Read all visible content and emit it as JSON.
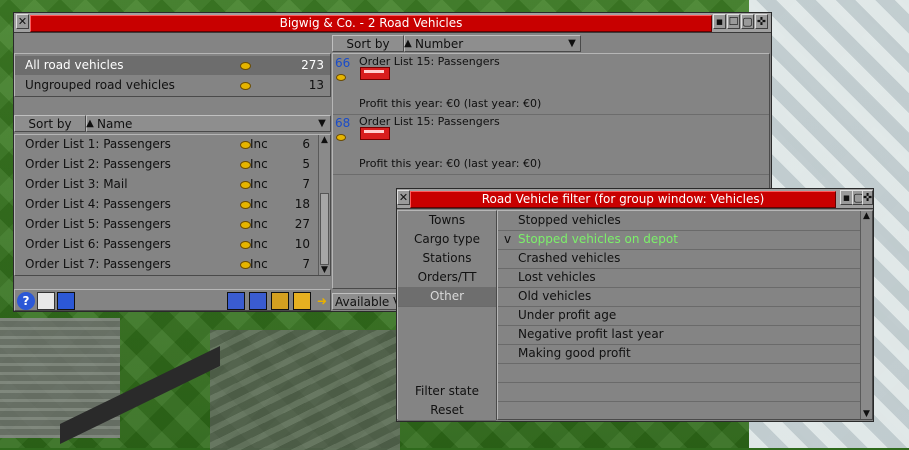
{
  "vehicles_window": {
    "title": "Bigwig & Co. - 2 Road Vehicles",
    "groups": [
      {
        "label": "All road vehicles",
        "count": "273"
      },
      {
        "label": "Ungrouped road vehicles",
        "count": "13"
      }
    ],
    "group_sort": {
      "label": "Sort by",
      "value": "Name"
    },
    "group_list": [
      {
        "label": "Order List 1: Passengers",
        "tag": "Inc",
        "count": "6"
      },
      {
        "label": "Order List 2: Passengers",
        "tag": "Inc",
        "count": "5"
      },
      {
        "label": "Order List 3: Mail",
        "tag": "Inc",
        "count": "7"
      },
      {
        "label": "Order List 4: Passengers",
        "tag": "Inc",
        "count": "18"
      },
      {
        "label": "Order List 5: Passengers",
        "tag": "Inc",
        "count": "27"
      },
      {
        "label": "Order List 6: Passengers",
        "tag": "Inc",
        "count": "10"
      },
      {
        "label": "Order List 7: Passengers",
        "tag": "Inc",
        "count": "7"
      }
    ],
    "vehicle_sort": {
      "label": "Sort by",
      "value": "Number"
    },
    "vehicles": [
      {
        "number": "66",
        "orders": "Order List 15: Passengers",
        "profit": "Profit this year: €0 (last year: €0)"
      },
      {
        "number": "68",
        "orders": "Order List 15: Passengers",
        "profit": "Profit this year: €0 (last year: €0)"
      }
    ],
    "available_label": "Available V"
  },
  "filter_window": {
    "title": "Road Vehicle filter (for group window: Vehicles)",
    "categories": [
      "Towns",
      "Cargo type",
      "Stations",
      "Orders/TT",
      "Other"
    ],
    "active_category": "Other",
    "bottom_buttons": [
      "Filter state",
      "Reset"
    ],
    "filters": [
      {
        "label": "Stopped vehicles",
        "checked": false
      },
      {
        "label": "Stopped vehicles on depot",
        "checked": true,
        "mark": "v"
      },
      {
        "label": "Crashed vehicles",
        "checked": false
      },
      {
        "label": "Lost vehicles",
        "checked": false
      },
      {
        "label": "Old vehicles",
        "checked": false
      },
      {
        "label": "Under profit age",
        "checked": false
      },
      {
        "label": "Negative profit last year",
        "checked": false
      },
      {
        "label": "Making good profit",
        "checked": false
      }
    ]
  },
  "colors": {
    "title_red": "#c80000",
    "window_grey": "#848484",
    "checked_green": "#7cf06a",
    "vehicle_number_blue": "#1a4cc8"
  }
}
